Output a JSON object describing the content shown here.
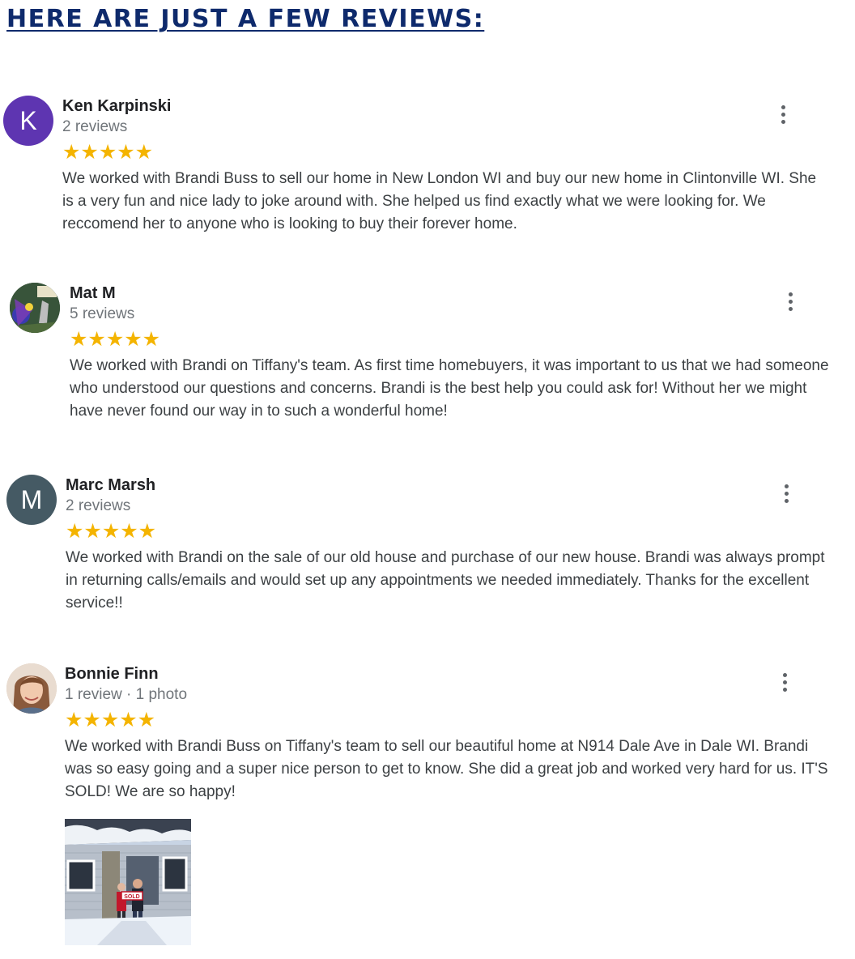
{
  "page": {
    "heading": "HERE ARE JUST A FEW REVIEWS:"
  },
  "reviews": [
    {
      "name": "Ken Karpinski",
      "meta": "2 reviews",
      "avatar_letter": "K",
      "avatar_color": "#5e35b1",
      "rating": 5,
      "stars": "★★★★★",
      "text": "We worked with Brandi Buss to sell our home in New London WI and buy our new home in Clintonville WI. She is a very fun and nice lady to joke around with. She helped us find exactly what we were looking for. We reccomend her to anyone who is looking to buy their forever home."
    },
    {
      "name": "Mat M",
      "meta": "5 reviews",
      "avatar_letter": "",
      "avatar_color": "#2e4a2a",
      "rating": 5,
      "stars": "★★★★★",
      "text": "We worked with Brandi on Tiffany's team. As first time homebuyers, it was important to us that we had someone who understood our questions and concerns. Brandi is the best help you could ask for! Without her we might have never found our way in to such a wonderful home!"
    },
    {
      "name": "Marc Marsh",
      "meta": "2 reviews",
      "avatar_letter": "M",
      "avatar_color": "#455a64",
      "rating": 5,
      "stars": "★★★★★",
      "text": "We worked with Brandi on the sale of our old house and purchase of our new house. Brandi was always prompt in returning calls/emails and would set up any appointments we needed immediately. Thanks for the excellent service!!"
    },
    {
      "name": "Bonnie Finn",
      "meta": "1 review · 1 photo",
      "avatar_letter": "",
      "avatar_color": "#c9a28a",
      "rating": 5,
      "stars": "★★★★★",
      "text": "We worked with Brandi Buss on Tiffany's team to sell our beautiful home at N914 Dale Ave in Dale WI. Brandi was so easy going and a super nice person to get to know. She did a great job and worked very hard for us. IT'S SOLD! We are so happy!"
    }
  ],
  "photo": {
    "sign_text": "SOLD"
  },
  "colors": {
    "heading": "#0e2a6c",
    "star": "#f4b400",
    "name": "#202124",
    "meta": "#70757a",
    "body": "#3c4043"
  }
}
